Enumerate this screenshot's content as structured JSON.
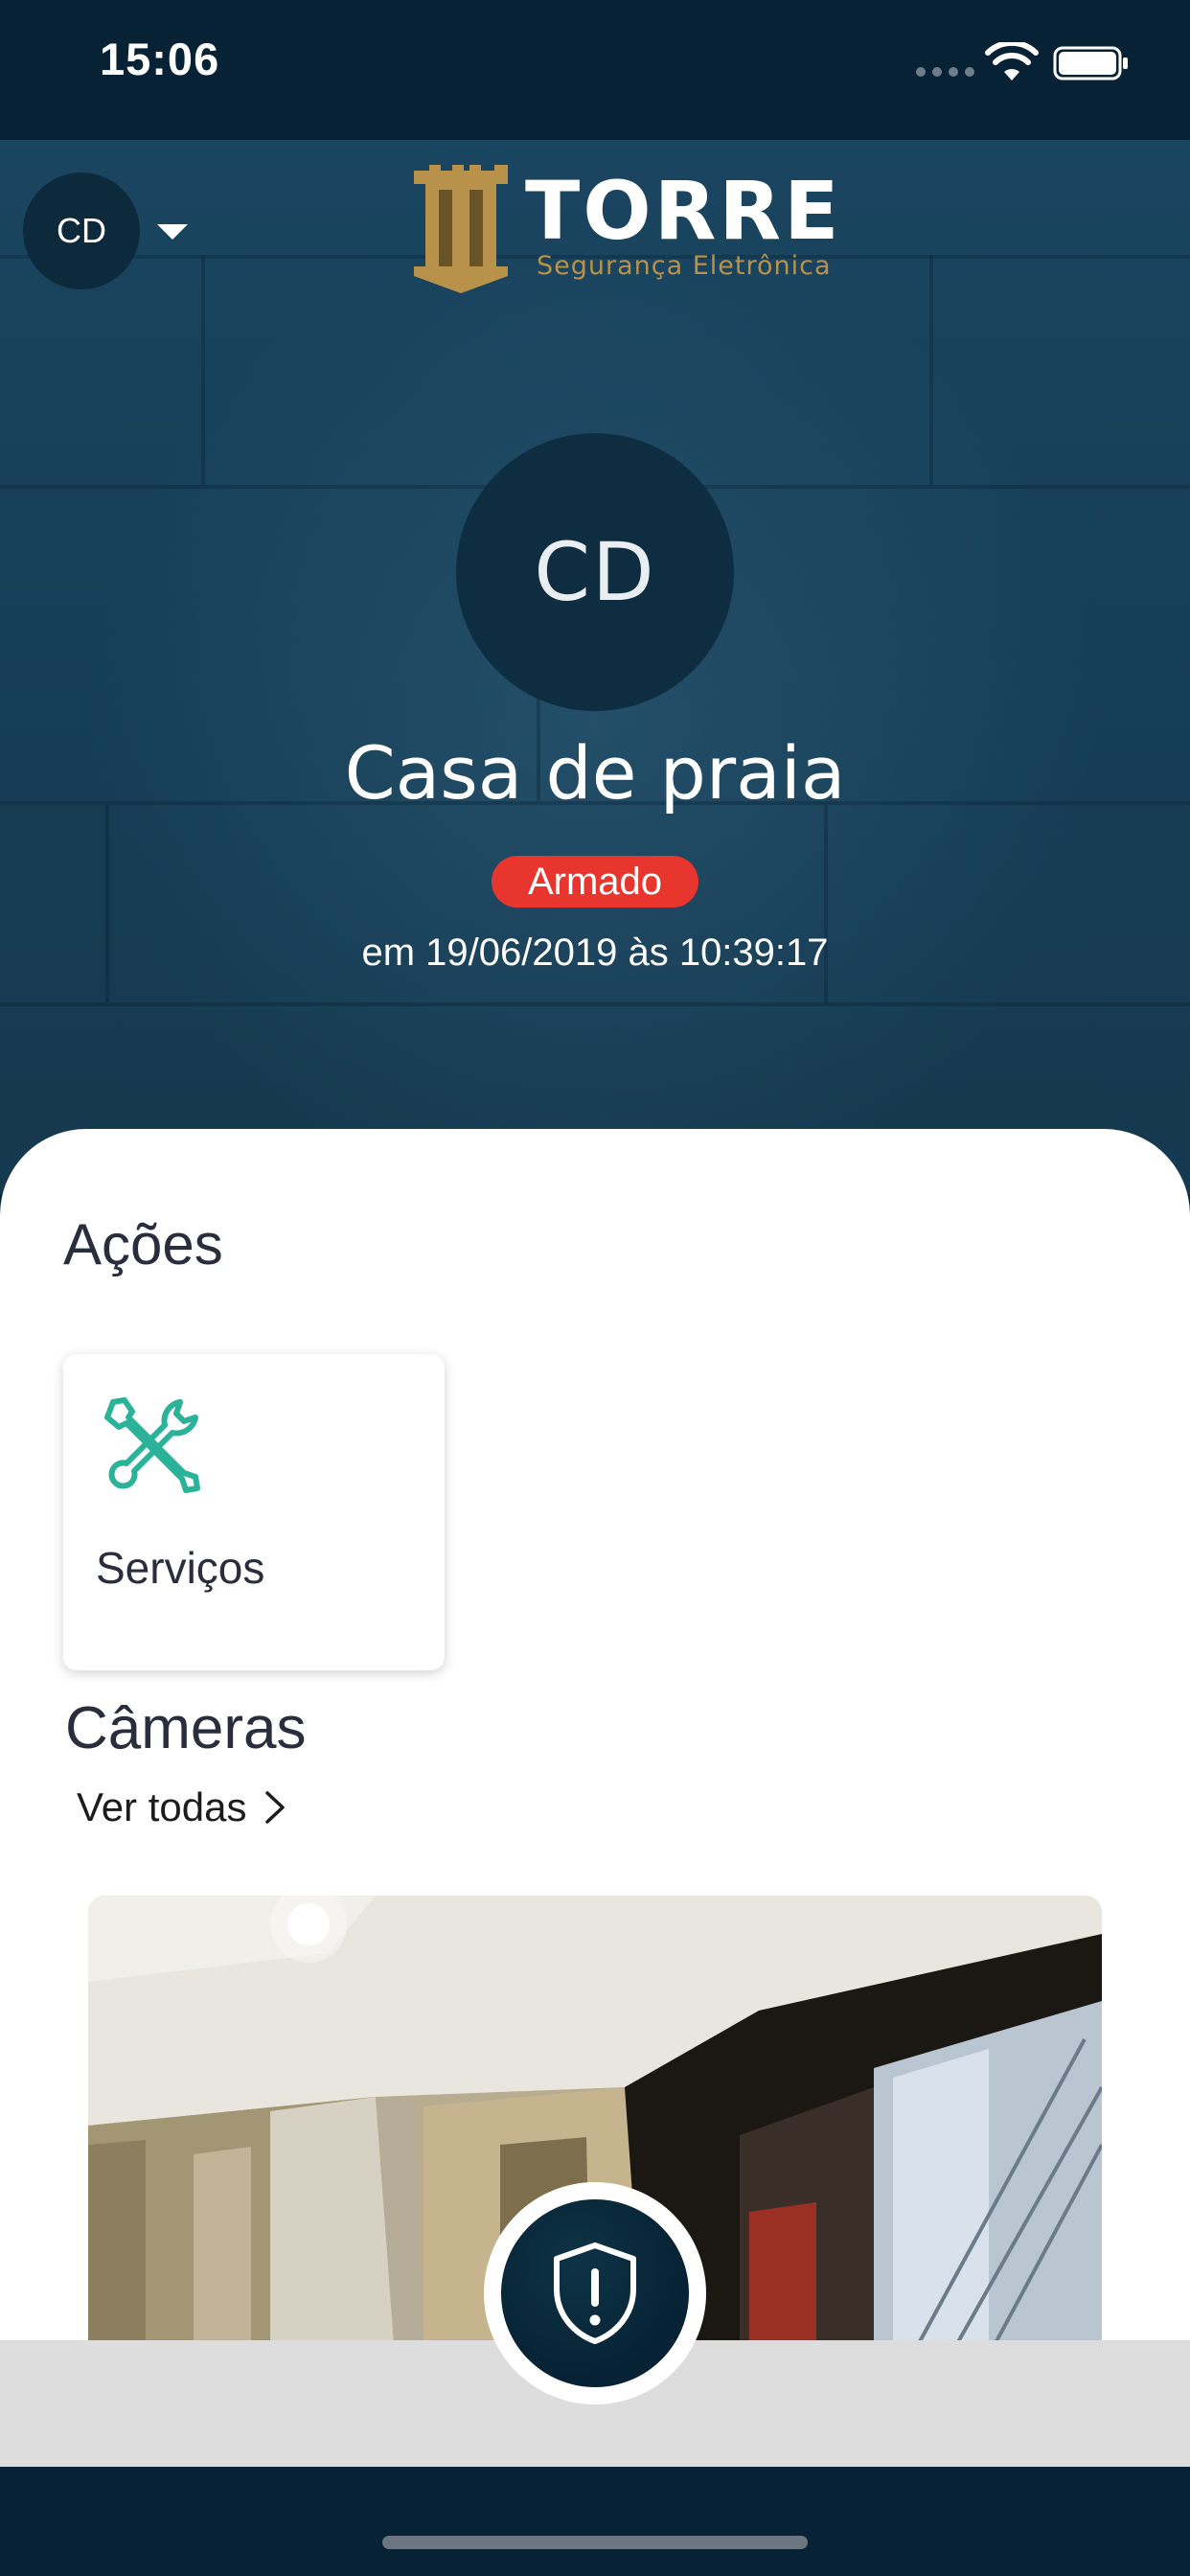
{
  "status_bar": {
    "time": "15:06"
  },
  "header": {
    "account_initials": "CD",
    "logo_title": "TORRE",
    "logo_subtitle": "Segurança Eletrônica"
  },
  "site": {
    "initials": "CD",
    "name": "Casa de praia",
    "status": "Armado",
    "status_color": "#e8352e",
    "status_date": "em 19/06/2019 às 10:39:17"
  },
  "actions": {
    "title": "Ações",
    "items": [
      {
        "label": "Serviços",
        "icon": "tools-icon",
        "icon_color": "#2bb39a"
      }
    ]
  },
  "cameras": {
    "title": "Câmeras",
    "see_all_label": "Ver todas"
  },
  "panic_button": {
    "icon": "shield-alert-icon"
  },
  "colors": {
    "header_background": "#062234",
    "brand_gold": "#b8924a",
    "accent_green": "#2bb39a"
  }
}
